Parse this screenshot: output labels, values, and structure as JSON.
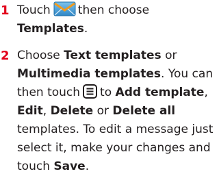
{
  "step1": {
    "number": "1",
    "lead": "Touch",
    "after_icon": "then choose",
    "templates": "Templates",
    "end": ".",
    "icon": "messaging-envelope-icon",
    "icon_colors": {
      "body": "#5aa6d9",
      "flap": "#f29a1d"
    }
  },
  "step2": {
    "number": "2",
    "choose": "Choose",
    "text_templates": "Text templates",
    "or": "or",
    "multimedia_templates": "Multimedia templates",
    "you_can": ". You can",
    "then_touch": "then touch",
    "to": "to",
    "add_template": "Add template",
    "comma": ",",
    "edit": "Edit",
    "delete": "Delete",
    "delete_all": "Delete all",
    "line5": "templates. To edit a message just",
    "line6": "select it, make your changes and",
    "touch": "touch",
    "save": "Save",
    "end": ".",
    "icon": "menu-icon"
  },
  "colors": {
    "number": "#e2001a",
    "text": "#231f20"
  }
}
